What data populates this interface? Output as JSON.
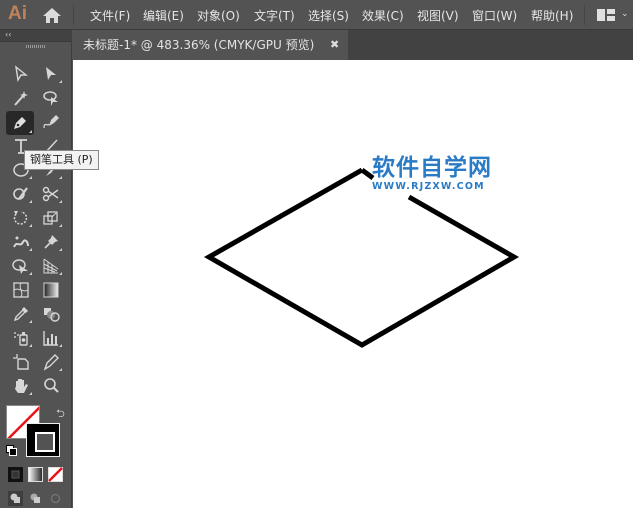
{
  "app": {
    "logo": "Ai",
    "home_icon": "home-icon"
  },
  "menu": [
    {
      "label": "文件(F)"
    },
    {
      "label": "编辑(E)"
    },
    {
      "label": "对象(O)"
    },
    {
      "label": "文字(T)"
    },
    {
      "label": "选择(S)"
    },
    {
      "label": "效果(C)"
    },
    {
      "label": "视图(V)"
    },
    {
      "label": "窗口(W)"
    },
    {
      "label": "帮助(H)"
    }
  ],
  "workspace": {
    "icon": "workspace-layout-icon",
    "dropdown": "⌄"
  },
  "document_tab": {
    "title": "未标题-1* @ 483.36% (CMYK/GPU 预览)",
    "close": "✖"
  },
  "toolbar": {
    "collapse": "‹‹",
    "tooltip": "钢笔工具 (P)",
    "active_tool": "pen",
    "tools": [
      "selection-tool",
      "direct-selection-tool",
      "magic-wand-tool",
      "lasso-tool",
      "pen-tool",
      "curvature-tool",
      "type-tool",
      "line-segment-tool",
      "ellipse-tool",
      "paintbrush-tool",
      "shaper-tool",
      "scissors-tool",
      "rotate-tool",
      "scale-tool",
      "puppet-warp-tool",
      "pin-tool",
      "free-transform-tool",
      "perspective-grid-tool",
      "mesh-tool",
      "gradient-tool",
      "eyedropper-tool",
      "blend-tool",
      "symbol-sprayer-tool",
      "column-graph-tool",
      "artboard-tool",
      "slice-tool",
      "hand-tool",
      "zoom-tool"
    ]
  },
  "colors": {
    "fill": "none",
    "stroke": "#000000",
    "accent_red": "#e8141b",
    "watermark": "#2a7bc6"
  },
  "watermark": {
    "cn": "软件自学网",
    "en": "WWW.RJZXW.COM"
  },
  "artwork": {
    "shape": "diamond-path",
    "stroke_color": "#000000",
    "fill": "none"
  }
}
